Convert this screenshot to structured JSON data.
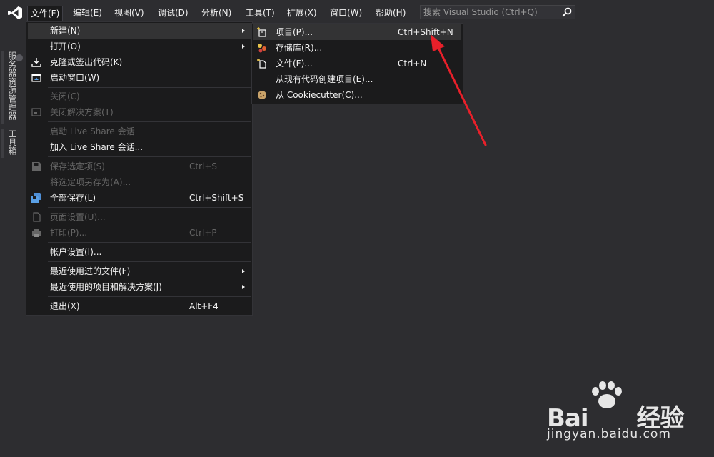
{
  "menubar": {
    "logo_icon": "visual-studio-logo-icon",
    "items": [
      {
        "label": "文件(F)",
        "active": true
      },
      {
        "label": "编辑(E)"
      },
      {
        "label": "视图(V)"
      },
      {
        "label": "调试(D)"
      },
      {
        "label": "分析(N)"
      },
      {
        "label": "工具(T)"
      },
      {
        "label": "扩展(X)"
      },
      {
        "label": "窗口(W)"
      },
      {
        "label": "帮助(H)"
      }
    ],
    "search": {
      "placeholder": "搜索 Visual Studio (Ctrl+Q)",
      "icon": "search-icon"
    }
  },
  "side_tabs": [
    {
      "label": "服务器资源管理器"
    },
    {
      "label": "工具箱"
    }
  ],
  "file_menu": {
    "items": [
      {
        "label": "新建(N)",
        "submenu": true,
        "highlighted": true
      },
      {
        "label": "打开(O)",
        "submenu": true
      },
      {
        "label": "克隆或签出代码(K)",
        "icon": "clone-download-icon"
      },
      {
        "label": "启动窗口(W)",
        "icon": "start-window-icon"
      },
      {
        "label": "关闭(C)",
        "disabled": true
      },
      {
        "label": "关闭解决方案(T)",
        "icon": "close-solution-icon",
        "disabled": true
      },
      {
        "label": "启动 Live Share 会话",
        "disabled": true
      },
      {
        "label": "加入 Live Share 会话..."
      },
      {
        "label": "保存选定项(S)",
        "shortcut": "Ctrl+S",
        "icon": "save-icon",
        "disabled": true
      },
      {
        "label": "将选定项另存为(A)...",
        "disabled": true
      },
      {
        "label": "全部保存(L)",
        "shortcut": "Ctrl+Shift+S",
        "icon": "save-all-icon"
      },
      {
        "label": "页面设置(U)...",
        "icon": "page-setup-icon",
        "disabled": true
      },
      {
        "label": "打印(P)...",
        "shortcut": "Ctrl+P",
        "icon": "print-icon",
        "disabled": true
      },
      {
        "label": "帐户设置(I)..."
      },
      {
        "label": "最近使用过的文件(F)",
        "submenu": true
      },
      {
        "label": "最近使用的项目和解决方案(J)",
        "submenu": true
      },
      {
        "label": "退出(X)",
        "shortcut": "Alt+F4"
      }
    ]
  },
  "new_submenu": {
    "items": [
      {
        "label": "项目(P)...",
        "shortcut": "Ctrl+Shift+N",
        "icon": "new-project-icon",
        "highlighted": true
      },
      {
        "label": "存储库(R)...",
        "icon": "repository-icon"
      },
      {
        "label": "文件(F)...",
        "shortcut": "Ctrl+N",
        "icon": "new-file-icon"
      },
      {
        "label": "从现有代码创建项目(E)..."
      },
      {
        "label": "从 Cookiecutter(C)...",
        "icon": "cookiecutter-icon"
      }
    ]
  },
  "annotation": {
    "color": "#e8202a"
  },
  "watermark": {
    "brand_left": "Bai",
    "brand_right": "经验",
    "url": "jingyan.baidu.com"
  },
  "colors": {
    "background": "#2d2d30",
    "menu_bg": "#1b1b1c",
    "highlight": "#333334",
    "disabled_text": "#656565",
    "vs_purple": "#9b6ad6"
  }
}
